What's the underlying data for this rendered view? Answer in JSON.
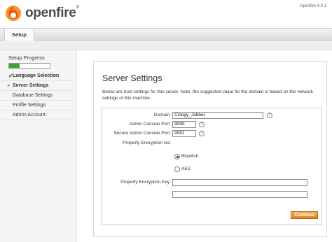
{
  "header": {
    "brand": "openfire",
    "trademark": "®",
    "version": "Openfire 4.0.1"
  },
  "nav": {
    "tab_label": "Setup"
  },
  "sidebar": {
    "title": "Setup Progress",
    "progress": 0.25,
    "items": [
      {
        "label": "Language Selection",
        "state": "done"
      },
      {
        "label": "Server Settings",
        "state": "current"
      },
      {
        "label": "Database Settings",
        "state": "pending"
      },
      {
        "label": "Profile Settings",
        "state": "pending"
      },
      {
        "label": "Admin Account",
        "state": "pending"
      }
    ]
  },
  "main": {
    "title": "Server Settings",
    "description": "Below are host settings for this server. Note: the suggested value for the domain is based on the network settings of this machine.",
    "domain_label": "Domain:",
    "domain_value": "Cinegy_Jabber",
    "admin_port_label": "Admin Console Port:",
    "admin_port_value": "9090",
    "secure_port_label": "Secure Admin Console Port:",
    "secure_port_value": "9091",
    "encryption_via_label": "Property Encryption via:",
    "blowfish_label": "Blowfish",
    "aes_label": "AES",
    "encryption_key_label": "Property Encryption Key:",
    "encryption_key_value": "",
    "encryption_key_confirm_value": "",
    "help_glyph": "?",
    "continue_label": "Continue"
  },
  "colors": {
    "accent": "#db8424",
    "progress": "#3aa33a",
    "check": "#2e9d2e"
  }
}
